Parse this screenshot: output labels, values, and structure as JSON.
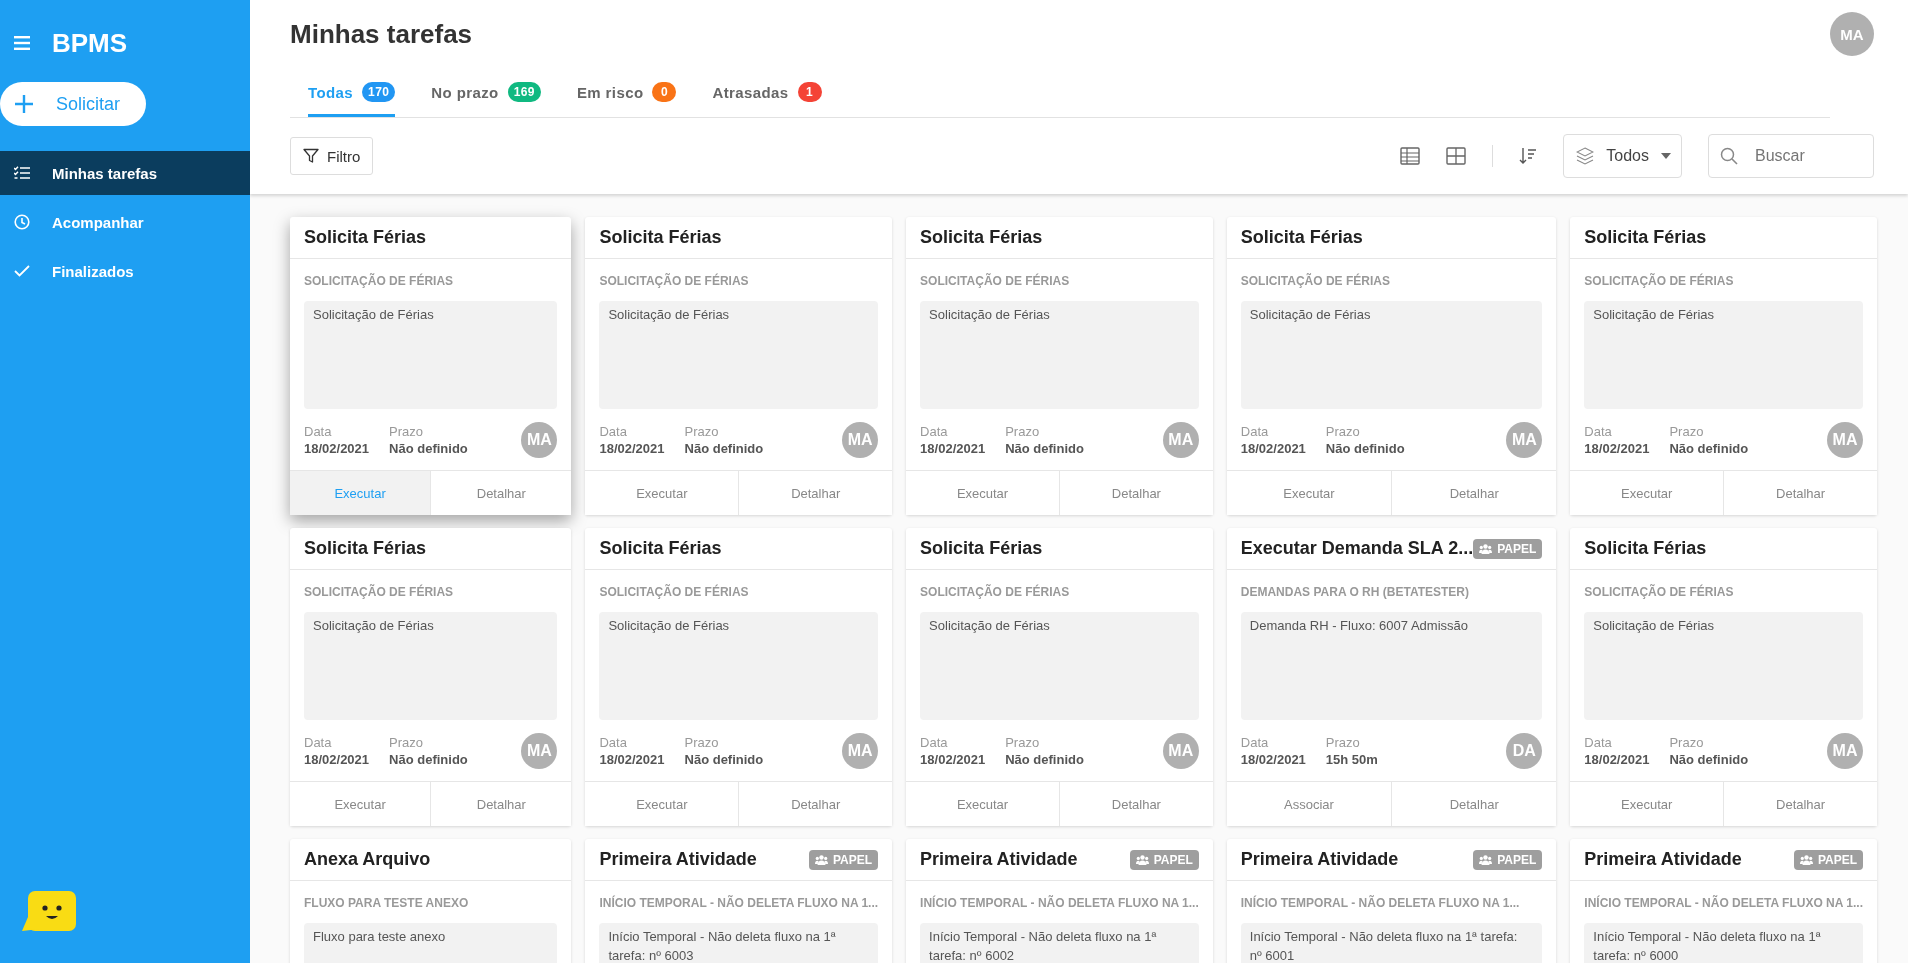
{
  "sidebar": {
    "brand": "BPMS",
    "new_button": "Solicitar",
    "items": [
      {
        "label": "Minhas tarefas",
        "selected": true
      },
      {
        "label": "Acompanhar",
        "selected": false
      },
      {
        "label": "Finalizados",
        "selected": false
      }
    ]
  },
  "header": {
    "title": "Minhas tarefas",
    "avatar": "MA"
  },
  "tabs": [
    {
      "label": "Todas",
      "count": "170",
      "color": "#2196f3",
      "selected": true
    },
    {
      "label": "No prazo",
      "count": "169",
      "color": "#10b981",
      "selected": false
    },
    {
      "label": "Em risco",
      "count": "0",
      "color": "#f97316",
      "selected": false
    },
    {
      "label": "Atrasadas",
      "count": "1",
      "color": "#f44336",
      "selected": false
    }
  ],
  "toolbar": {
    "filter": "Filtro",
    "scope": "Todos",
    "search": {
      "placeholder": "Buscar"
    }
  },
  "cards": [
    {
      "title": "Solicita Férias",
      "subtitle": "SOLICITAÇÃO DE FÉRIAS",
      "description": "Solicitação de Férias",
      "date_label": "Data",
      "date": "18/02/2021",
      "deadline_label": "Prazo",
      "deadline": "Não definido",
      "avatar": "MA",
      "actions": [
        "Executar",
        "Detalhar"
      ],
      "hovered": true
    },
    {
      "title": "Solicita Férias",
      "subtitle": "SOLICITAÇÃO DE FÉRIAS",
      "description": "Solicitação de Férias",
      "date_label": "Data",
      "date": "18/02/2021",
      "deadline_label": "Prazo",
      "deadline": "Não definido",
      "avatar": "MA",
      "actions": [
        "Executar",
        "Detalhar"
      ],
      "hovered": false
    },
    {
      "title": "Solicita Férias",
      "subtitle": "SOLICITAÇÃO DE FÉRIAS",
      "description": "Solicitação de Férias",
      "date_label": "Data",
      "date": "18/02/2021",
      "deadline_label": "Prazo",
      "deadline": "Não definido",
      "avatar": "MA",
      "actions": [
        "Executar",
        "Detalhar"
      ],
      "hovered": false
    },
    {
      "title": "Solicita Férias",
      "subtitle": "SOLICITAÇÃO DE FÉRIAS",
      "description": "Solicitação de Férias",
      "date_label": "Data",
      "date": "18/02/2021",
      "deadline_label": "Prazo",
      "deadline": "Não definido",
      "avatar": "MA",
      "actions": [
        "Executar",
        "Detalhar"
      ],
      "hovered": false
    },
    {
      "title": "Solicita Férias",
      "subtitle": "SOLICITAÇÃO DE FÉRIAS",
      "description": "Solicitação de Férias",
      "date_label": "Data",
      "date": "18/02/2021",
      "deadline_label": "Prazo",
      "deadline": "Não definido",
      "avatar": "MA",
      "actions": [
        "Executar",
        "Detalhar"
      ],
      "hovered": false
    },
    {
      "title": "Solicita Férias",
      "subtitle": "SOLICITAÇÃO DE FÉRIAS",
      "description": "Solicitação de Férias",
      "date_label": "Data",
      "date": "18/02/2021",
      "deadline_label": "Prazo",
      "deadline": "Não definido",
      "avatar": "MA",
      "actions": [
        "Executar",
        "Detalhar"
      ],
      "hovered": false
    },
    {
      "title": "Solicita Férias",
      "subtitle": "SOLICITAÇÃO DE FÉRIAS",
      "description": "Solicitação de Férias",
      "date_label": "Data",
      "date": "18/02/2021",
      "deadline_label": "Prazo",
      "deadline": "Não definido",
      "avatar": "MA",
      "actions": [
        "Executar",
        "Detalhar"
      ],
      "hovered": false
    },
    {
      "title": "Solicita Férias",
      "subtitle": "SOLICITAÇÃO DE FÉRIAS",
      "description": "Solicitação de Férias",
      "date_label": "Data",
      "date": "18/02/2021",
      "deadline_label": "Prazo",
      "deadline": "Não definido",
      "avatar": "MA",
      "actions": [
        "Executar",
        "Detalhar"
      ],
      "hovered": false
    },
    {
      "title": "Executar Demanda SLA 2...",
      "badge": "PAPEL",
      "subtitle": "DEMANDAS PARA O RH (BETATESTER)",
      "description": "Demanda RH - Fluxo: 6007 Admissão",
      "date_label": "Data",
      "date": "18/02/2021",
      "deadline_label": "Prazo",
      "deadline": "15h 50m",
      "avatar": "DA",
      "actions": [
        "Associar",
        "Detalhar"
      ],
      "hovered": false
    },
    {
      "title": "Solicita Férias",
      "subtitle": "SOLICITAÇÃO DE FÉRIAS",
      "description": "Solicitação de Férias",
      "date_label": "Data",
      "date": "18/02/2021",
      "deadline_label": "Prazo",
      "deadline": "Não definido",
      "avatar": "MA",
      "actions": [
        "Executar",
        "Detalhar"
      ],
      "hovered": false
    },
    {
      "title": "Anexa Arquivo",
      "subtitle": "FLUXO PARA TESTE ANEXO",
      "description": "Fluxo para teste anexo",
      "hovered": false
    },
    {
      "title": "Primeira Atividade",
      "badge": "PAPEL",
      "subtitle": "INÍCIO TEMPORAL - NÃO DELETA FLUXO NA 1...",
      "description": "Início Temporal - Não deleta fluxo na 1ª tarefa: nº 6003",
      "hovered": false
    },
    {
      "title": "Primeira Atividade",
      "badge": "PAPEL",
      "subtitle": "INÍCIO TEMPORAL - NÃO DELETA FLUXO NA 1...",
      "description": "Início Temporal - Não deleta fluxo na 1ª tarefa: nº 6002",
      "hovered": false
    },
    {
      "title": "Primeira Atividade",
      "badge": "PAPEL",
      "subtitle": "INÍCIO TEMPORAL - NÃO DELETA FLUXO NA 1...",
      "description": "Início Temporal - Não deleta fluxo na 1ª tarefa: nº 6001",
      "hovered": false
    },
    {
      "title": "Primeira Atividade",
      "badge": "PAPEL",
      "subtitle": "INÍCIO TEMPORAL - NÃO DELETA FLUXO NA 1...",
      "description": "Início Temporal - Não deleta fluxo na 1ª tarefa: nº 6000",
      "hovered": false
    }
  ]
}
